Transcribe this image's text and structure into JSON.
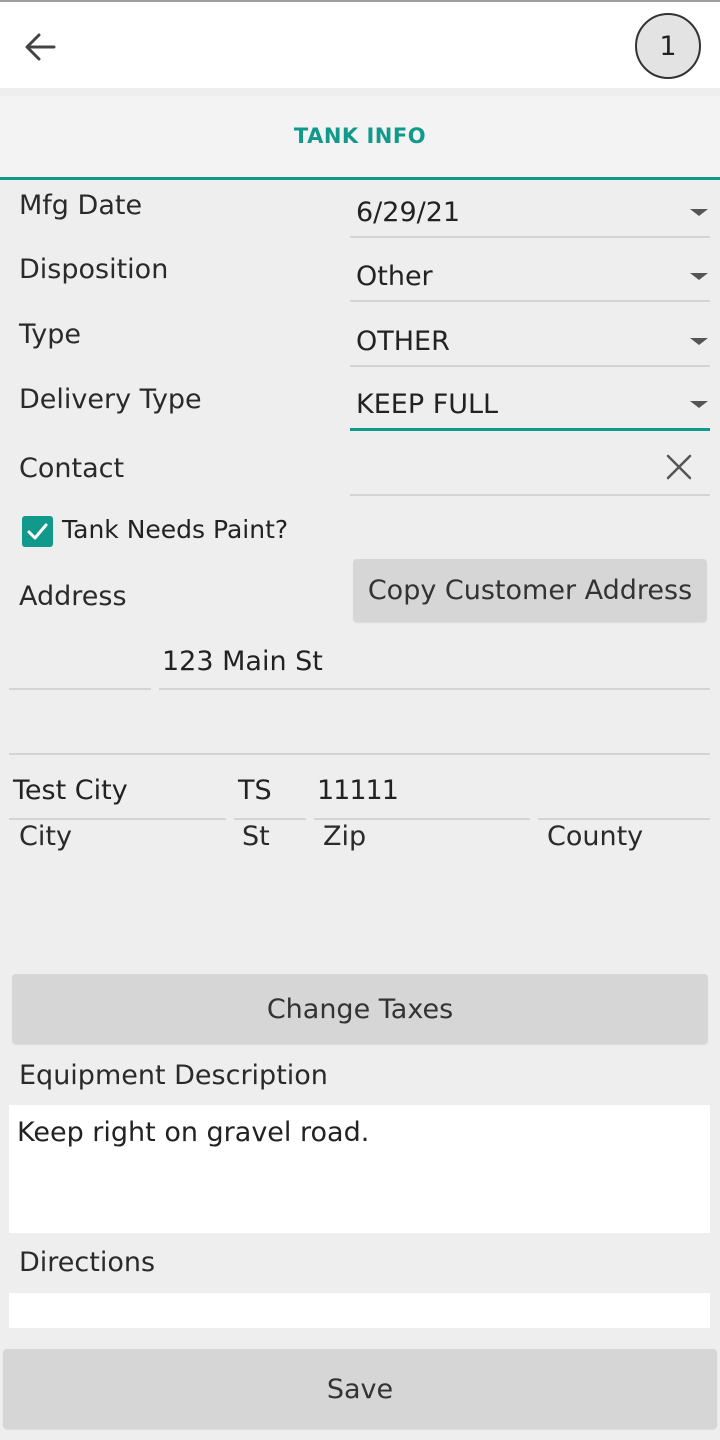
{
  "header": {
    "back_icon": "arrow-left-icon",
    "badge": "1"
  },
  "tab": {
    "label": "TANK INFO",
    "accent": "#119a8c"
  },
  "form": {
    "mfg_date": {
      "label": "Mfg Date",
      "value": "6/29/21"
    },
    "disposition": {
      "label": "Disposition",
      "value": "Other"
    },
    "type": {
      "label": "Type",
      "value": "OTHER"
    },
    "delivery_type": {
      "label": "Delivery Type",
      "value": "KEEP FULL"
    },
    "contact": {
      "label": "Contact",
      "value": ""
    },
    "tank_needs_paint": {
      "label": "Tank Needs Paint?",
      "checked": true
    },
    "address": {
      "label": "Address",
      "copy_button": "Copy Customer Address",
      "line1_prefix": "",
      "line1": "123 Main St",
      "line2": "",
      "city": "Test City",
      "state": "TS",
      "zip": "11111",
      "county": "",
      "city_label": "City",
      "state_label": "St",
      "zip_label": "Zip",
      "county_label": "County"
    },
    "change_taxes_button": "Change Taxes",
    "equipment_description": {
      "label": "Equipment Description",
      "value": "Keep right on gravel road."
    },
    "directions": {
      "label": "Directions",
      "value": ""
    }
  },
  "footer": {
    "save_button": "Save"
  }
}
